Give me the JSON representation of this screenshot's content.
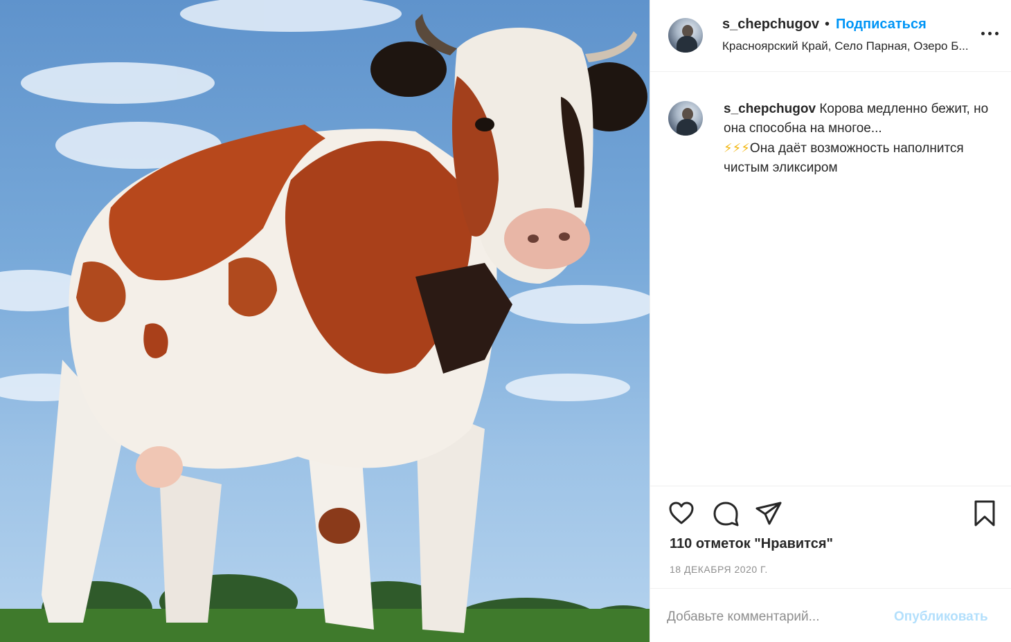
{
  "post": {
    "username": "s_chepchugov",
    "separator": "•",
    "follow_label": "Подписаться",
    "location": "Красноярский Край, Село Парная, Озеро Б...",
    "more_icon": "more-horizontal-icon"
  },
  "caption": {
    "username": "s_chepchugov",
    "text_part1": "Корова медленно бежит, но она способна на многое...",
    "emoji": "⚡⚡⚡",
    "text_part2": "Она даёт возможность наполнится чистым эликсиром"
  },
  "actions": {
    "icons": [
      "heart-icon",
      "comment-icon",
      "share-icon",
      "bookmark-icon"
    ],
    "likes_text": "110 отметок \"Нравится\"",
    "date": "18 ДЕКАБРЯ 2020 Г."
  },
  "comment": {
    "placeholder": "Добавьте комментарий...",
    "publish_label": "Опубликовать"
  },
  "photo": {
    "subject": "cow-photo"
  },
  "colors": {
    "link_blue": "#0095f6",
    "publish_disabled": "#b2dffc",
    "muted_gray": "#8e8e8e",
    "text": "#262626",
    "border": "#efefef"
  }
}
